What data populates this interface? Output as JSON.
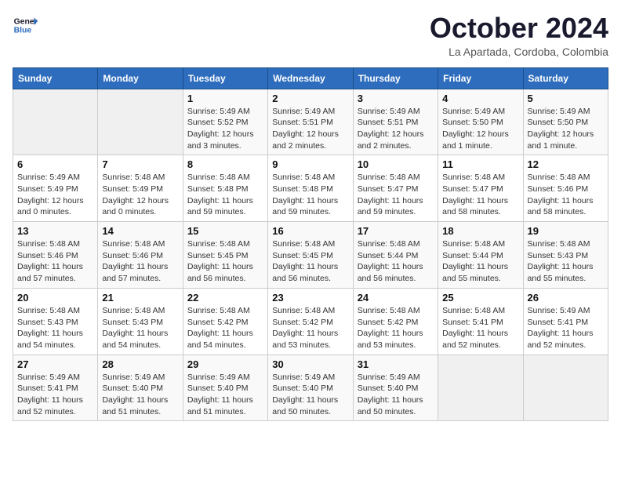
{
  "header": {
    "logo_line1": "General",
    "logo_line2": "Blue",
    "month_title": "October 2024",
    "location": "La Apartada, Cordoba, Colombia"
  },
  "columns": [
    "Sunday",
    "Monday",
    "Tuesday",
    "Wednesday",
    "Thursday",
    "Friday",
    "Saturday"
  ],
  "weeks": [
    [
      {
        "day": "",
        "detail": ""
      },
      {
        "day": "",
        "detail": ""
      },
      {
        "day": "1",
        "detail": "Sunrise: 5:49 AM\nSunset: 5:52 PM\nDaylight: 12 hours\nand 3 minutes."
      },
      {
        "day": "2",
        "detail": "Sunrise: 5:49 AM\nSunset: 5:51 PM\nDaylight: 12 hours\nand 2 minutes."
      },
      {
        "day": "3",
        "detail": "Sunrise: 5:49 AM\nSunset: 5:51 PM\nDaylight: 12 hours\nand 2 minutes."
      },
      {
        "day": "4",
        "detail": "Sunrise: 5:49 AM\nSunset: 5:50 PM\nDaylight: 12 hours\nand 1 minute."
      },
      {
        "day": "5",
        "detail": "Sunrise: 5:49 AM\nSunset: 5:50 PM\nDaylight: 12 hours\nand 1 minute."
      }
    ],
    [
      {
        "day": "6",
        "detail": "Sunrise: 5:49 AM\nSunset: 5:49 PM\nDaylight: 12 hours\nand 0 minutes."
      },
      {
        "day": "7",
        "detail": "Sunrise: 5:48 AM\nSunset: 5:49 PM\nDaylight: 12 hours\nand 0 minutes."
      },
      {
        "day": "8",
        "detail": "Sunrise: 5:48 AM\nSunset: 5:48 PM\nDaylight: 11 hours\nand 59 minutes."
      },
      {
        "day": "9",
        "detail": "Sunrise: 5:48 AM\nSunset: 5:48 PM\nDaylight: 11 hours\nand 59 minutes."
      },
      {
        "day": "10",
        "detail": "Sunrise: 5:48 AM\nSunset: 5:47 PM\nDaylight: 11 hours\nand 59 minutes."
      },
      {
        "day": "11",
        "detail": "Sunrise: 5:48 AM\nSunset: 5:47 PM\nDaylight: 11 hours\nand 58 minutes."
      },
      {
        "day": "12",
        "detail": "Sunrise: 5:48 AM\nSunset: 5:46 PM\nDaylight: 11 hours\nand 58 minutes."
      }
    ],
    [
      {
        "day": "13",
        "detail": "Sunrise: 5:48 AM\nSunset: 5:46 PM\nDaylight: 11 hours\nand 57 minutes."
      },
      {
        "day": "14",
        "detail": "Sunrise: 5:48 AM\nSunset: 5:46 PM\nDaylight: 11 hours\nand 57 minutes."
      },
      {
        "day": "15",
        "detail": "Sunrise: 5:48 AM\nSunset: 5:45 PM\nDaylight: 11 hours\nand 56 minutes."
      },
      {
        "day": "16",
        "detail": "Sunrise: 5:48 AM\nSunset: 5:45 PM\nDaylight: 11 hours\nand 56 minutes."
      },
      {
        "day": "17",
        "detail": "Sunrise: 5:48 AM\nSunset: 5:44 PM\nDaylight: 11 hours\nand 56 minutes."
      },
      {
        "day": "18",
        "detail": "Sunrise: 5:48 AM\nSunset: 5:44 PM\nDaylight: 11 hours\nand 55 minutes."
      },
      {
        "day": "19",
        "detail": "Sunrise: 5:48 AM\nSunset: 5:43 PM\nDaylight: 11 hours\nand 55 minutes."
      }
    ],
    [
      {
        "day": "20",
        "detail": "Sunrise: 5:48 AM\nSunset: 5:43 PM\nDaylight: 11 hours\nand 54 minutes."
      },
      {
        "day": "21",
        "detail": "Sunrise: 5:48 AM\nSunset: 5:43 PM\nDaylight: 11 hours\nand 54 minutes."
      },
      {
        "day": "22",
        "detail": "Sunrise: 5:48 AM\nSunset: 5:42 PM\nDaylight: 11 hours\nand 54 minutes."
      },
      {
        "day": "23",
        "detail": "Sunrise: 5:48 AM\nSunset: 5:42 PM\nDaylight: 11 hours\nand 53 minutes."
      },
      {
        "day": "24",
        "detail": "Sunrise: 5:48 AM\nSunset: 5:42 PM\nDaylight: 11 hours\nand 53 minutes."
      },
      {
        "day": "25",
        "detail": "Sunrise: 5:48 AM\nSunset: 5:41 PM\nDaylight: 11 hours\nand 52 minutes."
      },
      {
        "day": "26",
        "detail": "Sunrise: 5:49 AM\nSunset: 5:41 PM\nDaylight: 11 hours\nand 52 minutes."
      }
    ],
    [
      {
        "day": "27",
        "detail": "Sunrise: 5:49 AM\nSunset: 5:41 PM\nDaylight: 11 hours\nand 52 minutes."
      },
      {
        "day": "28",
        "detail": "Sunrise: 5:49 AM\nSunset: 5:40 PM\nDaylight: 11 hours\nand 51 minutes."
      },
      {
        "day": "29",
        "detail": "Sunrise: 5:49 AM\nSunset: 5:40 PM\nDaylight: 11 hours\nand 51 minutes."
      },
      {
        "day": "30",
        "detail": "Sunrise: 5:49 AM\nSunset: 5:40 PM\nDaylight: 11 hours\nand 50 minutes."
      },
      {
        "day": "31",
        "detail": "Sunrise: 5:49 AM\nSunset: 5:40 PM\nDaylight: 11 hours\nand 50 minutes."
      },
      {
        "day": "",
        "detail": ""
      },
      {
        "day": "",
        "detail": ""
      }
    ]
  ]
}
